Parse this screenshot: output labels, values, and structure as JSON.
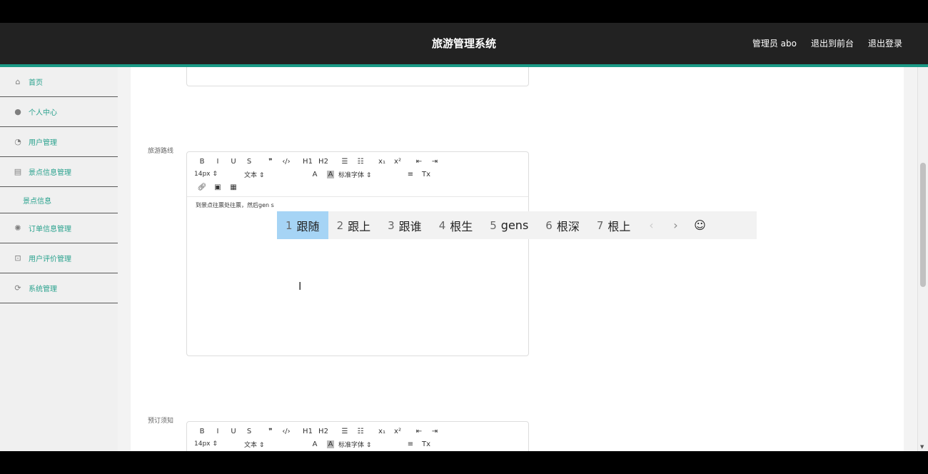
{
  "header": {
    "title": "旅游管理系统",
    "admin": "管理员 abo",
    "front": "退出到前台",
    "logout": "退出登录"
  },
  "sidebar": {
    "items": [
      {
        "label": "首页",
        "icon": "home-icon"
      },
      {
        "label": "个人中心",
        "icon": "user-icon"
      },
      {
        "label": "用户管理",
        "icon": "users-icon"
      },
      {
        "label": "景点信息管理",
        "icon": "list-icon"
      }
    ],
    "sub": "景点信息",
    "items2": [
      {
        "label": "订单信息管理",
        "icon": "settings-icon"
      },
      {
        "label": "用户评价管理",
        "icon": "cart-icon"
      },
      {
        "label": "系统管理",
        "icon": "gear-icon"
      }
    ]
  },
  "form": {
    "route_label": "旅游路线",
    "route_text": "到景点往票处往票，然后gen s",
    "notice_label": "预订须知"
  },
  "toolbar": {
    "row1": [
      "B",
      "I",
      "U",
      "S",
      "❞",
      "‹/›",
      "H1",
      "H2",
      "☰",
      "☷",
      "x₁",
      "x²",
      "⇤",
      "⇥"
    ],
    "size": "14px",
    "style": "文本",
    "font_color_icon": "A",
    "bg_icon": "A",
    "font": "标准字体",
    "align_icon": "≡",
    "clear_icon": "Tx"
  },
  "ime": {
    "candidates": [
      {
        "num": "1",
        "text": "跟随"
      },
      {
        "num": "2",
        "text": "跟上"
      },
      {
        "num": "3",
        "text": "跟谁"
      },
      {
        "num": "4",
        "text": "根生"
      },
      {
        "num": "5",
        "text": "gens"
      },
      {
        "num": "6",
        "text": "根深"
      },
      {
        "num": "7",
        "text": "根上"
      }
    ],
    "prev": "‹",
    "next": "›",
    "emoji": "☺"
  }
}
